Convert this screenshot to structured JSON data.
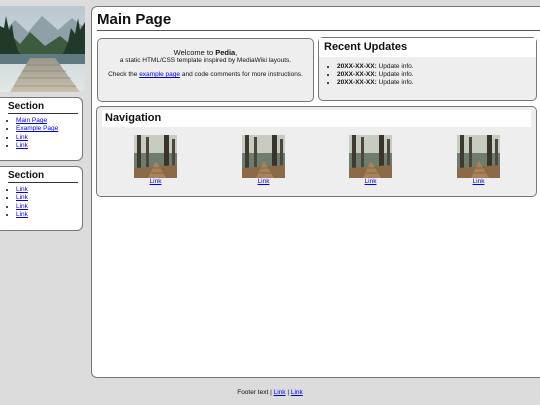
{
  "logo": {
    "image": "landscape-logo"
  },
  "sidebar": {
    "sections": [
      {
        "title": "Section",
        "links": [
          "Main Page",
          "Example Page",
          "Link",
          "Link"
        ]
      },
      {
        "title": "Section",
        "links": [
          "Link",
          "Link",
          "Link",
          "Link"
        ]
      }
    ]
  },
  "main": {
    "title": "Main Page",
    "welcome": {
      "line1_prefix": "Welcome to ",
      "line1_bold": "Pedia",
      "line1_suffix": ",",
      "line2": "a static HTML/CSS template inspired by MediaWiki layouts.",
      "line3_prefix": "Check the ",
      "line3_link": "example page",
      "line3_suffix": " and code comments for more instructions."
    },
    "updates": {
      "title": "Recent Updates",
      "items": [
        {
          "date": "20XX-XX-XX:",
          "text": " Update info."
        },
        {
          "date": "20XX-XX-XX:",
          "text": " Update info."
        },
        {
          "date": "20XX-XX-XX:",
          "text": " Update info."
        }
      ]
    },
    "navigation": {
      "title": "Navigation",
      "items": [
        {
          "label": "Link",
          "image": "forest-photo"
        },
        {
          "label": "Link",
          "image": "forest-photo"
        },
        {
          "label": "Link",
          "image": "forest-photo"
        },
        {
          "label": "Link",
          "image": "forest-photo"
        }
      ]
    }
  },
  "footer": {
    "text": "Footer text | ",
    "link1": "Link",
    "sep": " | ",
    "link2": "Link"
  }
}
